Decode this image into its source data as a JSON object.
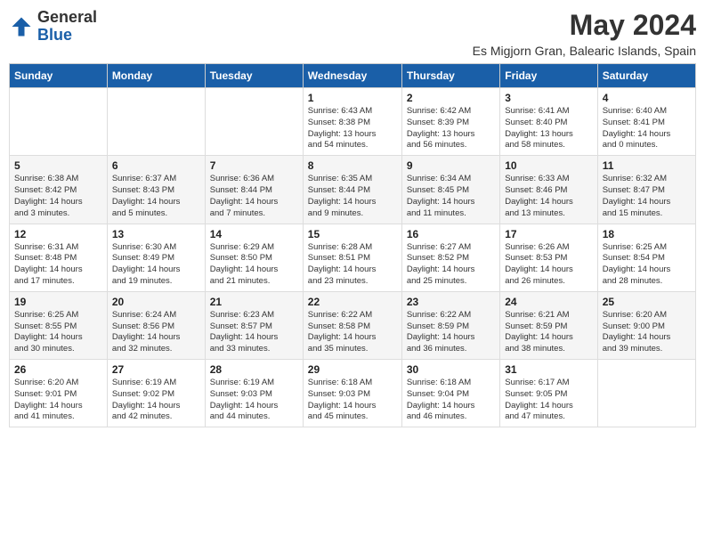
{
  "logo": {
    "general": "General",
    "blue": "Blue"
  },
  "title": {
    "month": "May 2024",
    "location": "Es Migjorn Gran, Balearic Islands, Spain"
  },
  "headers": [
    "Sunday",
    "Monday",
    "Tuesday",
    "Wednesday",
    "Thursday",
    "Friday",
    "Saturday"
  ],
  "weeks": [
    [
      {
        "day": "",
        "info": ""
      },
      {
        "day": "",
        "info": ""
      },
      {
        "day": "",
        "info": ""
      },
      {
        "day": "1",
        "info": "Sunrise: 6:43 AM\nSunset: 8:38 PM\nDaylight: 13 hours\nand 54 minutes."
      },
      {
        "day": "2",
        "info": "Sunrise: 6:42 AM\nSunset: 8:39 PM\nDaylight: 13 hours\nand 56 minutes."
      },
      {
        "day": "3",
        "info": "Sunrise: 6:41 AM\nSunset: 8:40 PM\nDaylight: 13 hours\nand 58 minutes."
      },
      {
        "day": "4",
        "info": "Sunrise: 6:40 AM\nSunset: 8:41 PM\nDaylight: 14 hours\nand 0 minutes."
      }
    ],
    [
      {
        "day": "5",
        "info": "Sunrise: 6:38 AM\nSunset: 8:42 PM\nDaylight: 14 hours\nand 3 minutes."
      },
      {
        "day": "6",
        "info": "Sunrise: 6:37 AM\nSunset: 8:43 PM\nDaylight: 14 hours\nand 5 minutes."
      },
      {
        "day": "7",
        "info": "Sunrise: 6:36 AM\nSunset: 8:44 PM\nDaylight: 14 hours\nand 7 minutes."
      },
      {
        "day": "8",
        "info": "Sunrise: 6:35 AM\nSunset: 8:44 PM\nDaylight: 14 hours\nand 9 minutes."
      },
      {
        "day": "9",
        "info": "Sunrise: 6:34 AM\nSunset: 8:45 PM\nDaylight: 14 hours\nand 11 minutes."
      },
      {
        "day": "10",
        "info": "Sunrise: 6:33 AM\nSunset: 8:46 PM\nDaylight: 14 hours\nand 13 minutes."
      },
      {
        "day": "11",
        "info": "Sunrise: 6:32 AM\nSunset: 8:47 PM\nDaylight: 14 hours\nand 15 minutes."
      }
    ],
    [
      {
        "day": "12",
        "info": "Sunrise: 6:31 AM\nSunset: 8:48 PM\nDaylight: 14 hours\nand 17 minutes."
      },
      {
        "day": "13",
        "info": "Sunrise: 6:30 AM\nSunset: 8:49 PM\nDaylight: 14 hours\nand 19 minutes."
      },
      {
        "day": "14",
        "info": "Sunrise: 6:29 AM\nSunset: 8:50 PM\nDaylight: 14 hours\nand 21 minutes."
      },
      {
        "day": "15",
        "info": "Sunrise: 6:28 AM\nSunset: 8:51 PM\nDaylight: 14 hours\nand 23 minutes."
      },
      {
        "day": "16",
        "info": "Sunrise: 6:27 AM\nSunset: 8:52 PM\nDaylight: 14 hours\nand 25 minutes."
      },
      {
        "day": "17",
        "info": "Sunrise: 6:26 AM\nSunset: 8:53 PM\nDaylight: 14 hours\nand 26 minutes."
      },
      {
        "day": "18",
        "info": "Sunrise: 6:25 AM\nSunset: 8:54 PM\nDaylight: 14 hours\nand 28 minutes."
      }
    ],
    [
      {
        "day": "19",
        "info": "Sunrise: 6:25 AM\nSunset: 8:55 PM\nDaylight: 14 hours\nand 30 minutes."
      },
      {
        "day": "20",
        "info": "Sunrise: 6:24 AM\nSunset: 8:56 PM\nDaylight: 14 hours\nand 32 minutes."
      },
      {
        "day": "21",
        "info": "Sunrise: 6:23 AM\nSunset: 8:57 PM\nDaylight: 14 hours\nand 33 minutes."
      },
      {
        "day": "22",
        "info": "Sunrise: 6:22 AM\nSunset: 8:58 PM\nDaylight: 14 hours\nand 35 minutes."
      },
      {
        "day": "23",
        "info": "Sunrise: 6:22 AM\nSunset: 8:59 PM\nDaylight: 14 hours\nand 36 minutes."
      },
      {
        "day": "24",
        "info": "Sunrise: 6:21 AM\nSunset: 8:59 PM\nDaylight: 14 hours\nand 38 minutes."
      },
      {
        "day": "25",
        "info": "Sunrise: 6:20 AM\nSunset: 9:00 PM\nDaylight: 14 hours\nand 39 minutes."
      }
    ],
    [
      {
        "day": "26",
        "info": "Sunrise: 6:20 AM\nSunset: 9:01 PM\nDaylight: 14 hours\nand 41 minutes."
      },
      {
        "day": "27",
        "info": "Sunrise: 6:19 AM\nSunset: 9:02 PM\nDaylight: 14 hours\nand 42 minutes."
      },
      {
        "day": "28",
        "info": "Sunrise: 6:19 AM\nSunset: 9:03 PM\nDaylight: 14 hours\nand 44 minutes."
      },
      {
        "day": "29",
        "info": "Sunrise: 6:18 AM\nSunset: 9:03 PM\nDaylight: 14 hours\nand 45 minutes."
      },
      {
        "day": "30",
        "info": "Sunrise: 6:18 AM\nSunset: 9:04 PM\nDaylight: 14 hours\nand 46 minutes."
      },
      {
        "day": "31",
        "info": "Sunrise: 6:17 AM\nSunset: 9:05 PM\nDaylight: 14 hours\nand 47 minutes."
      },
      {
        "day": "",
        "info": ""
      }
    ]
  ]
}
